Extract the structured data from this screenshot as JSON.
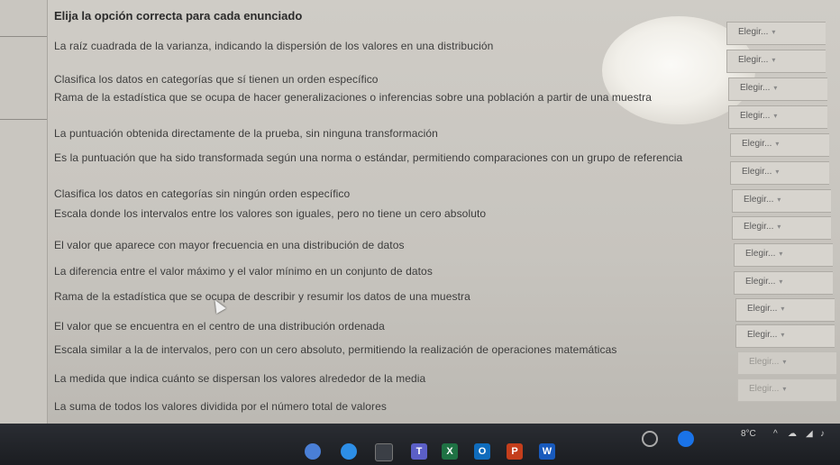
{
  "quiz": {
    "heading": "Elija la opción correcta para cada enunciado",
    "select_placeholder": "Elegir...",
    "statements": [
      "La raíz cuadrada de la varianza, indicando la dispersión de los valores en una distribución",
      "Clasifica los datos en categorías que sí tienen un orden específico",
      "Rama de la estadística que se ocupa de hacer generalizaciones o inferencias sobre una población a partir de una muestra",
      "La puntuación obtenida directamente de la prueba, sin ninguna transformación",
      "Es la puntuación que ha sido transformada según una norma o estándar, permitiendo comparaciones con un grupo de referencia",
      "Clasifica los datos en categorías sin ningún orden específico",
      "Escala donde los intervalos entre los valores son iguales, pero no tiene un cero absoluto",
      "El valor que aparece con mayor frecuencia en una distribución de datos",
      "La diferencia entre el valor máximo y el valor mínimo en un conjunto de datos",
      "Rama de la estadística que se ocupa de describir y resumir los datos de una muestra",
      "El valor que se encuentra en el centro de una distribución ordenada",
      "Escala similar a la de intervalos, pero con un cero absoluto, permitiendo la realización de operaciones matemáticas",
      "La medida que indica cuánto se dispersan los valores alrededor de la media",
      "La suma de todos los valores dividida por el número total de valores"
    ]
  },
  "taskbar": {
    "temperature": "8°C",
    "icons": [
      "files-icon",
      "chrome-icon",
      "edge-icon",
      "explorer-icon",
      "teams-icon",
      "excel-icon",
      "outlook-icon",
      "powerpoint-icon",
      "word-icon"
    ]
  },
  "colors": {
    "page_bg": "#cbc8c2",
    "taskbar_bg": "#1f2126"
  }
}
